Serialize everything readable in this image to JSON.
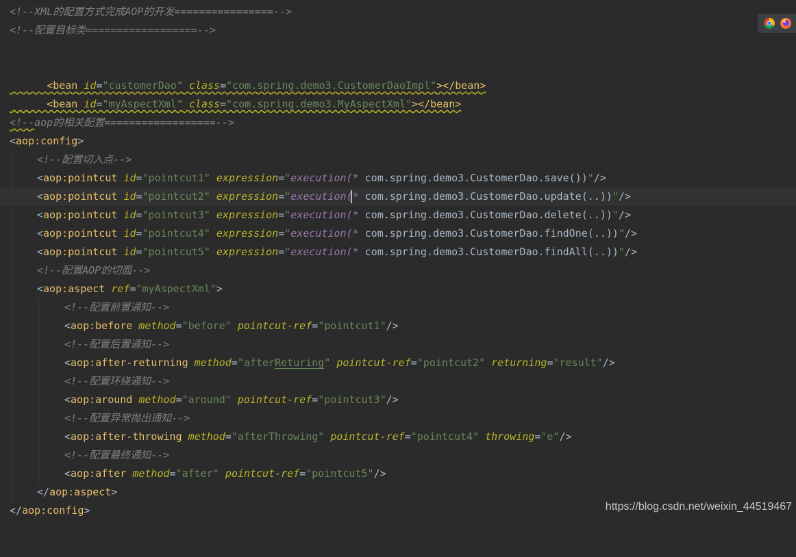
{
  "code_lines": [
    {
      "text": "<!--XML的配置方式完成AOP的开发================-->"
    },
    {
      "text": "<!--配置目标类==================-->"
    },
    {
      "text": ""
    },
    {
      "text": "<bean id=\"customerDao\" class=\"com.spring.demo3.CustomerDaoImpl\"></bean>"
    },
    {
      "text": "<bean id=\"myAspectXml\" class=\"com.spring.demo3.MyAspectXml\"></bean>"
    },
    {
      "text": ""
    },
    {
      "text": "<!--aop的相关配置==================-->"
    },
    {
      "text": "<aop:config>"
    },
    {
      "text": "<!--配置切入点-->"
    },
    {
      "text": "<aop:pointcut id=\"pointcut1\" expression=\"execution(* com.spring.demo3.CustomerDao.save())\"/>"
    },
    {
      "text": "<aop:pointcut id=\"pointcut2\" expression=\"execution(* com.spring.demo3.CustomerDao.update(..))\"/>"
    },
    {
      "text": "<aop:pointcut id=\"pointcut3\" expression=\"execution(* com.spring.demo3.CustomerDao.delete(..))\"/>"
    },
    {
      "text": "<aop:pointcut id=\"pointcut4\" expression=\"execution(* com.spring.demo3.CustomerDao.findOne(..))\"/>"
    },
    {
      "text": "<aop:pointcut id=\"pointcut5\" expression=\"execution(* com.spring.demo3.CustomerDao.findAll(..))\"/>"
    },
    {
      "text": "<!--配置AOP的切面-->"
    },
    {
      "text": "<aop:aspect ref=\"myAspectXml\">"
    },
    {
      "text": "<!--配置前置通知-->"
    },
    {
      "text": "<aop:before method=\"before\" pointcut-ref=\"pointcut1\"/>"
    },
    {
      "text": "<!--配置后置通知-->"
    },
    {
      "text": "<aop:after-returning method=\"afterReturing\" pointcut-ref=\"pointcut2\" returning=\"result\"/>"
    },
    {
      "text": "<!--配置环绕通知-->"
    },
    {
      "text": "<aop:around method=\"around\" pointcut-ref=\"pointcut3\"/>"
    },
    {
      "text": "<!--配置异常抛出通知-->"
    },
    {
      "text": "<aop:after-throwing method=\"afterThrowing\" pointcut-ref=\"pointcut4\" throwing=\"e\"/>"
    },
    {
      "text": "<!--配置最终通知-->"
    },
    {
      "text": "<aop:after method=\"after\" pointcut-ref=\"pointcut5\"/>"
    },
    {
      "text": "</aop:aspect>"
    },
    {
      "text": "</aop:config>"
    }
  ],
  "colors": {
    "background": "#2b2b2b",
    "current_line": "#323232",
    "comment": "#808080",
    "tag": "#e8bf6a",
    "attribute": "#bababa",
    "attribute_italic": "#bbb529",
    "string_value": "#6a8759",
    "keyword": "#9876aa",
    "plain": "#a9b7c6"
  },
  "browser_icons": [
    {
      "name": "chrome-icon"
    },
    {
      "name": "firefox-icon"
    }
  ],
  "watermark": "https://blog.csdn.net/weixin_44519467"
}
